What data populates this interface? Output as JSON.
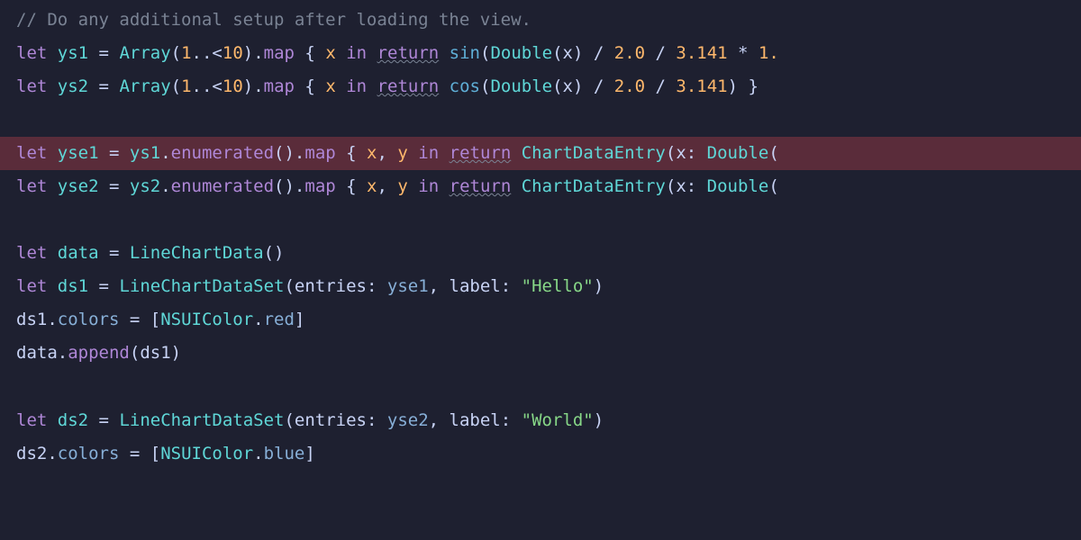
{
  "lines": [
    {
      "highlighted": false,
      "tokens": [
        {
          "cls": "comment",
          "text": "// Do any additional setup after loading the view."
        }
      ]
    },
    {
      "highlighted": false,
      "tokens": [
        {
          "cls": "keyword",
          "text": "let"
        },
        {
          "cls": "punct",
          "text": " "
        },
        {
          "cls": "var-decl",
          "text": "ys1"
        },
        {
          "cls": "punct",
          "text": " = "
        },
        {
          "cls": "type",
          "text": "Array"
        },
        {
          "cls": "punct",
          "text": "("
        },
        {
          "cls": "number",
          "text": "1"
        },
        {
          "cls": "punct",
          "text": "..<"
        },
        {
          "cls": "number",
          "text": "10"
        },
        {
          "cls": "punct",
          "text": ")."
        },
        {
          "cls": "method",
          "text": "map"
        },
        {
          "cls": "punct",
          "text": " { "
        },
        {
          "cls": "param",
          "text": "x"
        },
        {
          "cls": "punct",
          "text": " "
        },
        {
          "cls": "keyword",
          "text": "in"
        },
        {
          "cls": "punct",
          "text": " "
        },
        {
          "cls": "keyword underline",
          "text": "return"
        },
        {
          "cls": "punct",
          "text": " "
        },
        {
          "cls": "func",
          "text": "sin"
        },
        {
          "cls": "punct",
          "text": "("
        },
        {
          "cls": "type",
          "text": "Double"
        },
        {
          "cls": "punct",
          "text": "("
        },
        {
          "cls": "identifier",
          "text": "x"
        },
        {
          "cls": "punct",
          "text": ") / "
        },
        {
          "cls": "number",
          "text": "2.0"
        },
        {
          "cls": "punct",
          "text": " / "
        },
        {
          "cls": "number",
          "text": "3.141"
        },
        {
          "cls": "punct",
          "text": " * "
        },
        {
          "cls": "number",
          "text": "1."
        }
      ]
    },
    {
      "highlighted": false,
      "tokens": [
        {
          "cls": "keyword",
          "text": "let"
        },
        {
          "cls": "punct",
          "text": " "
        },
        {
          "cls": "var-decl",
          "text": "ys2"
        },
        {
          "cls": "punct",
          "text": " = "
        },
        {
          "cls": "type",
          "text": "Array"
        },
        {
          "cls": "punct",
          "text": "("
        },
        {
          "cls": "number",
          "text": "1"
        },
        {
          "cls": "punct",
          "text": "..<"
        },
        {
          "cls": "number",
          "text": "10"
        },
        {
          "cls": "punct",
          "text": ")."
        },
        {
          "cls": "method",
          "text": "map"
        },
        {
          "cls": "punct",
          "text": " { "
        },
        {
          "cls": "param",
          "text": "x"
        },
        {
          "cls": "punct",
          "text": " "
        },
        {
          "cls": "keyword",
          "text": "in"
        },
        {
          "cls": "punct",
          "text": " "
        },
        {
          "cls": "keyword underline",
          "text": "return"
        },
        {
          "cls": "punct",
          "text": " "
        },
        {
          "cls": "func",
          "text": "cos"
        },
        {
          "cls": "punct",
          "text": "("
        },
        {
          "cls": "type",
          "text": "Double"
        },
        {
          "cls": "punct",
          "text": "("
        },
        {
          "cls": "identifier",
          "text": "x"
        },
        {
          "cls": "punct",
          "text": ") / "
        },
        {
          "cls": "number",
          "text": "2.0"
        },
        {
          "cls": "punct",
          "text": " / "
        },
        {
          "cls": "number",
          "text": "3.141"
        },
        {
          "cls": "punct",
          "text": ") }"
        }
      ]
    },
    {
      "highlighted": false,
      "tokens": [
        {
          "cls": "punct",
          "text": " "
        }
      ]
    },
    {
      "highlighted": true,
      "tokens": [
        {
          "cls": "keyword",
          "text": "let"
        },
        {
          "cls": "punct",
          "text": " "
        },
        {
          "cls": "var-decl",
          "text": "yse1"
        },
        {
          "cls": "punct",
          "text": " = "
        },
        {
          "cls": "type",
          "text": "ys1"
        },
        {
          "cls": "punct",
          "text": "."
        },
        {
          "cls": "method",
          "text": "enumerated"
        },
        {
          "cls": "punct",
          "text": "()."
        },
        {
          "cls": "method",
          "text": "map"
        },
        {
          "cls": "punct",
          "text": " { "
        },
        {
          "cls": "param",
          "text": "x"
        },
        {
          "cls": "punct",
          "text": ", "
        },
        {
          "cls": "param",
          "text": "y"
        },
        {
          "cls": "punct",
          "text": " "
        },
        {
          "cls": "keyword",
          "text": "in"
        },
        {
          "cls": "punct",
          "text": " "
        },
        {
          "cls": "keyword underline",
          "text": "return"
        },
        {
          "cls": "punct",
          "text": " "
        },
        {
          "cls": "type",
          "text": "ChartDataEntry"
        },
        {
          "cls": "punct",
          "text": "("
        },
        {
          "cls": "identifier",
          "text": "x"
        },
        {
          "cls": "punct",
          "text": ": "
        },
        {
          "cls": "type",
          "text": "Double"
        },
        {
          "cls": "punct",
          "text": "("
        }
      ]
    },
    {
      "highlighted": false,
      "tokens": [
        {
          "cls": "keyword",
          "text": "let"
        },
        {
          "cls": "punct",
          "text": " "
        },
        {
          "cls": "var-decl",
          "text": "yse2"
        },
        {
          "cls": "punct",
          "text": " = "
        },
        {
          "cls": "type",
          "text": "ys2"
        },
        {
          "cls": "punct",
          "text": "."
        },
        {
          "cls": "method",
          "text": "enumerated"
        },
        {
          "cls": "punct",
          "text": "()."
        },
        {
          "cls": "method",
          "text": "map"
        },
        {
          "cls": "punct",
          "text": " { "
        },
        {
          "cls": "param",
          "text": "x"
        },
        {
          "cls": "punct",
          "text": ", "
        },
        {
          "cls": "param",
          "text": "y"
        },
        {
          "cls": "punct",
          "text": " "
        },
        {
          "cls": "keyword",
          "text": "in"
        },
        {
          "cls": "punct",
          "text": " "
        },
        {
          "cls": "keyword underline",
          "text": "return"
        },
        {
          "cls": "punct",
          "text": " "
        },
        {
          "cls": "type",
          "text": "ChartDataEntry"
        },
        {
          "cls": "punct",
          "text": "("
        },
        {
          "cls": "identifier",
          "text": "x"
        },
        {
          "cls": "punct",
          "text": ": "
        },
        {
          "cls": "type",
          "text": "Double"
        },
        {
          "cls": "punct",
          "text": "("
        }
      ]
    },
    {
      "highlighted": false,
      "tokens": [
        {
          "cls": "punct",
          "text": " "
        }
      ]
    },
    {
      "highlighted": false,
      "tokens": [
        {
          "cls": "keyword",
          "text": "let"
        },
        {
          "cls": "punct",
          "text": " "
        },
        {
          "cls": "var-decl",
          "text": "data"
        },
        {
          "cls": "punct",
          "text": " = "
        },
        {
          "cls": "type",
          "text": "LineChartData"
        },
        {
          "cls": "punct",
          "text": "()"
        }
      ]
    },
    {
      "highlighted": false,
      "tokens": [
        {
          "cls": "keyword",
          "text": "let"
        },
        {
          "cls": "punct",
          "text": " "
        },
        {
          "cls": "var-decl",
          "text": "ds1"
        },
        {
          "cls": "punct",
          "text": " = "
        },
        {
          "cls": "type",
          "text": "LineChartDataSet"
        },
        {
          "cls": "punct",
          "text": "("
        },
        {
          "cls": "identifier",
          "text": "entries"
        },
        {
          "cls": "punct",
          "text": ": "
        },
        {
          "cls": "property",
          "text": "yse1"
        },
        {
          "cls": "punct",
          "text": ", "
        },
        {
          "cls": "identifier",
          "text": "label"
        },
        {
          "cls": "punct",
          "text": ": "
        },
        {
          "cls": "string",
          "text": "\"Hello\""
        },
        {
          "cls": "punct",
          "text": ")"
        }
      ]
    },
    {
      "highlighted": false,
      "tokens": [
        {
          "cls": "identifier",
          "text": "ds1"
        },
        {
          "cls": "punct",
          "text": "."
        },
        {
          "cls": "property",
          "text": "colors"
        },
        {
          "cls": "punct",
          "text": " = ["
        },
        {
          "cls": "type",
          "text": "NSUIColor"
        },
        {
          "cls": "punct",
          "text": "."
        },
        {
          "cls": "property",
          "text": "red"
        },
        {
          "cls": "punct",
          "text": "]"
        }
      ]
    },
    {
      "highlighted": false,
      "tokens": [
        {
          "cls": "identifier",
          "text": "data"
        },
        {
          "cls": "punct",
          "text": "."
        },
        {
          "cls": "method",
          "text": "append"
        },
        {
          "cls": "punct",
          "text": "("
        },
        {
          "cls": "identifier",
          "text": "ds1"
        },
        {
          "cls": "punct",
          "text": ")"
        }
      ]
    },
    {
      "highlighted": false,
      "tokens": [
        {
          "cls": "punct",
          "text": " "
        }
      ]
    },
    {
      "highlighted": false,
      "tokens": [
        {
          "cls": "keyword",
          "text": "let"
        },
        {
          "cls": "punct",
          "text": " "
        },
        {
          "cls": "var-decl",
          "text": "ds2"
        },
        {
          "cls": "punct",
          "text": " = "
        },
        {
          "cls": "type",
          "text": "LineChartDataSet"
        },
        {
          "cls": "punct",
          "text": "("
        },
        {
          "cls": "identifier",
          "text": "entries"
        },
        {
          "cls": "punct",
          "text": ": "
        },
        {
          "cls": "property",
          "text": "yse2"
        },
        {
          "cls": "punct",
          "text": ", "
        },
        {
          "cls": "identifier",
          "text": "label"
        },
        {
          "cls": "punct",
          "text": ": "
        },
        {
          "cls": "string",
          "text": "\"World\""
        },
        {
          "cls": "punct",
          "text": ")"
        }
      ]
    },
    {
      "highlighted": false,
      "tokens": [
        {
          "cls": "identifier",
          "text": "ds2"
        },
        {
          "cls": "punct",
          "text": "."
        },
        {
          "cls": "property",
          "text": "colors"
        },
        {
          "cls": "punct",
          "text": " = ["
        },
        {
          "cls": "type",
          "text": "NSUIColor"
        },
        {
          "cls": "punct",
          "text": "."
        },
        {
          "cls": "property",
          "text": "blue"
        },
        {
          "cls": "punct",
          "text": "]"
        }
      ]
    }
  ]
}
